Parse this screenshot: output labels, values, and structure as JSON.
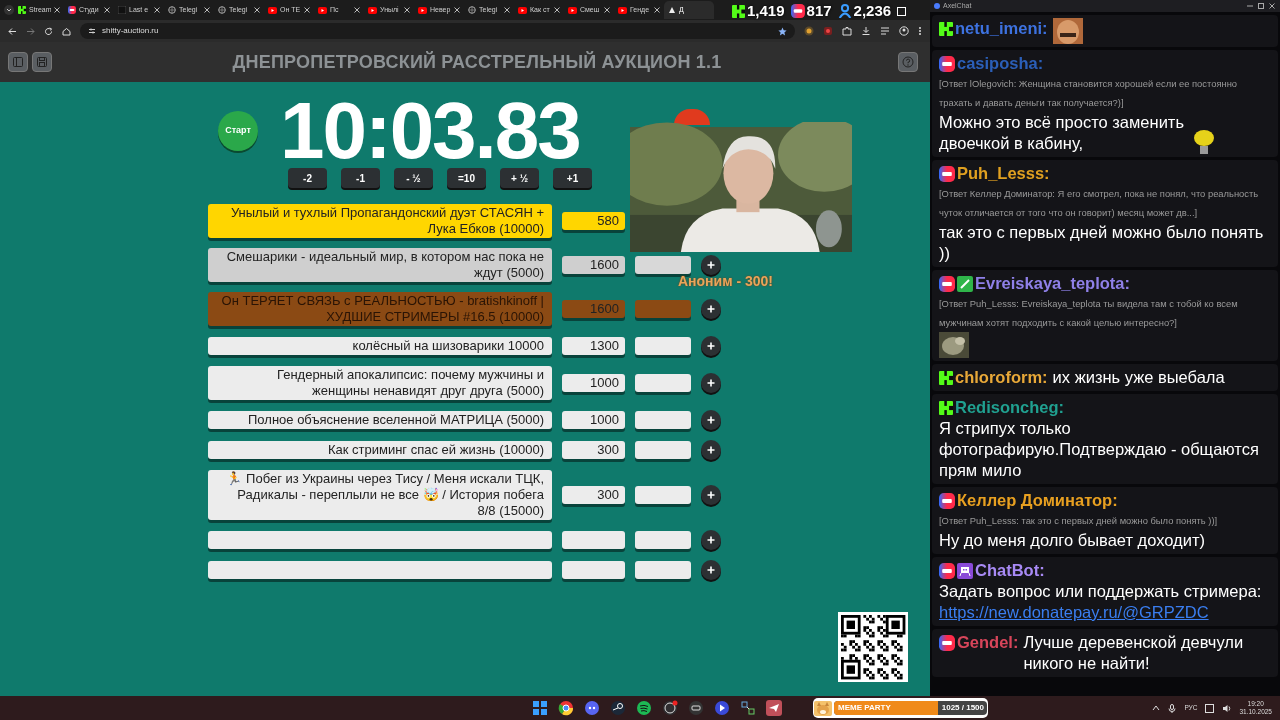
{
  "browser": {
    "tabs": [
      {
        "label": "Stream",
        "selected": false
      },
      {
        "label": "Студи",
        "selected": false
      },
      {
        "label": "Last e",
        "selected": false
      },
      {
        "label": "Telegi",
        "selected": false
      },
      {
        "label": "Telegi",
        "selected": false
      },
      {
        "label": "Он ТЕ",
        "selected": false
      },
      {
        "label": "Пс",
        "selected": false
      },
      {
        "label": "Унылі",
        "selected": false
      },
      {
        "label": "Невер",
        "selected": false
      },
      {
        "label": "Telegi",
        "selected": false
      },
      {
        "label": "Как ст",
        "selected": false
      },
      {
        "label": "Смеш",
        "selected": false
      },
      {
        "label": "Генде",
        "selected": false
      },
      {
        "label": "Д",
        "selected": true
      }
    ],
    "address": "shitty-auction.ru"
  },
  "stream_stats": [
    {
      "kind": "kick",
      "value": "1,419"
    },
    {
      "kind": "live",
      "value": "817"
    },
    {
      "kind": "viewers",
      "value": "2,236"
    }
  ],
  "auction": {
    "title": "ДНЕПРОПЕТРОВСКИЙ РАССТРЕЛЬНЫЙ АУКЦИОН 1.1",
    "start_button": "Старт",
    "timer": "10:03.83",
    "time_buttons": [
      "-2",
      "-1",
      "- ½",
      "=10",
      "+ ½",
      "+1"
    ],
    "lots": [
      {
        "name": "Унылый и тухлый Пропагандонский дуэт СТАСЯН + Лука Ебков (10000)",
        "amount": "580",
        "color": "#ffd600"
      },
      {
        "name": "Смешарики - идеальный мир, в котором нас пока не ждут (5000)",
        "amount": "1600",
        "color": "#cfcfcf"
      },
      {
        "name": "Он ТЕРЯЕТ СВЯЗЬ с РЕАЛЬНОСТЬЮ - bratishkinoff | ХУДШИЕ СТРИМЕРЫ #16.5 (10000)",
        "amount": "1600",
        "color": "#8b4a14"
      },
      {
        "name": "колёсный на шизоварики 10000",
        "amount": "1300",
        "color": "#ececec"
      },
      {
        "name": "Гендерный апокалипсис: почему мужчины и женщины ненавидят друг друга (5000)",
        "amount": "1000",
        "color": "#ececec"
      },
      {
        "name": "Полное объяснение вселенной МАТРИЦА (5000)",
        "amount": "1000",
        "color": "#ececec"
      },
      {
        "name": "Как стриминг спас ей жизнь (10000)",
        "amount": "300",
        "color": "#ececec"
      },
      {
        "name": "🏃 Побег из Украины через Тису / Меня искали ТЦК, Радикалы - переплыли не все 🤯 / История побега 8/8 (15000)",
        "amount": "300",
        "color": "#ececec"
      },
      {
        "color": "#ececec"
      },
      {
        "color": "#ececec"
      }
    ],
    "alert": "Аноним - 300!"
  },
  "chat": {
    "title": "AxelChat",
    "messages": [
      {
        "kind": "kick",
        "user": "netu_imeni:",
        "color": "#3d72e0"
      },
      {
        "kind": "live",
        "user": "casiposha:",
        "color": "#2b5fb8",
        "reply": "[Ответ lOlegovich: Женщина становится хорошей если ее постоянно трахать и давать деньги так получается?)]",
        "text": "Можно это всё просто заменить двоечкой в кабину,"
      },
      {
        "kind": "live",
        "user": "Puh_Lesss:",
        "color": "#e0a020",
        "reply": "[Ответ Келлер Доминатор: Я его смотрел, пока не понял, что реальность чуток отличается от того что он говорит) месяц может дв...]",
        "text": "так это с первых дней можно было понять ))"
      },
      {
        "kind": "live",
        "badge": {
          "kind": "vip"
        },
        "user": "Evreiskaya_teplota:",
        "color": "#8f80e8",
        "reply": "[Ответ Puh_Lesss: Evreiskaya_teplota ты видела там с тобой ко всем мужчинам хотят подходить с какой целью интересно?]"
      },
      {
        "kind": "kick",
        "user": "chloroform:",
        "color": "#e8a838",
        "text": "их жизнь уже выебала"
      },
      {
        "kind": "kick",
        "user": "Redisoncheg:",
        "color": "#20a090",
        "text": "Я стрипух только фотографирую.Подтверждаю - общаются прям мило"
      },
      {
        "kind": "live",
        "user": "Келлер Доминатор:",
        "color": "#e8a020",
        "reply": "[Ответ Puh_Lesss: так это с первых дней можно было понять ))]",
        "text": "Ну до меня долго бывает доходит)"
      },
      {
        "kind": "live",
        "badge": {
          "kind": "bot"
        },
        "user": "ChatBot:",
        "color": "#a88af5",
        "text": "Задать вопрос или поддержать стримера:",
        "link": "https://new.donatepay.ru/@GRPZDC"
      },
      {
        "kind": "live",
        "user": "Gendel:",
        "color": "#d8455a",
        "text": "Лучше деревенской девчули никого не найти!"
      }
    ]
  },
  "taskbar": {
    "widget": {
      "title": "MEME PARTY",
      "progress": "1025 / 1500",
      "level": 0.68
    },
    "language": "РУС",
    "time": "19:20",
    "date": "31.10.2025"
  }
}
